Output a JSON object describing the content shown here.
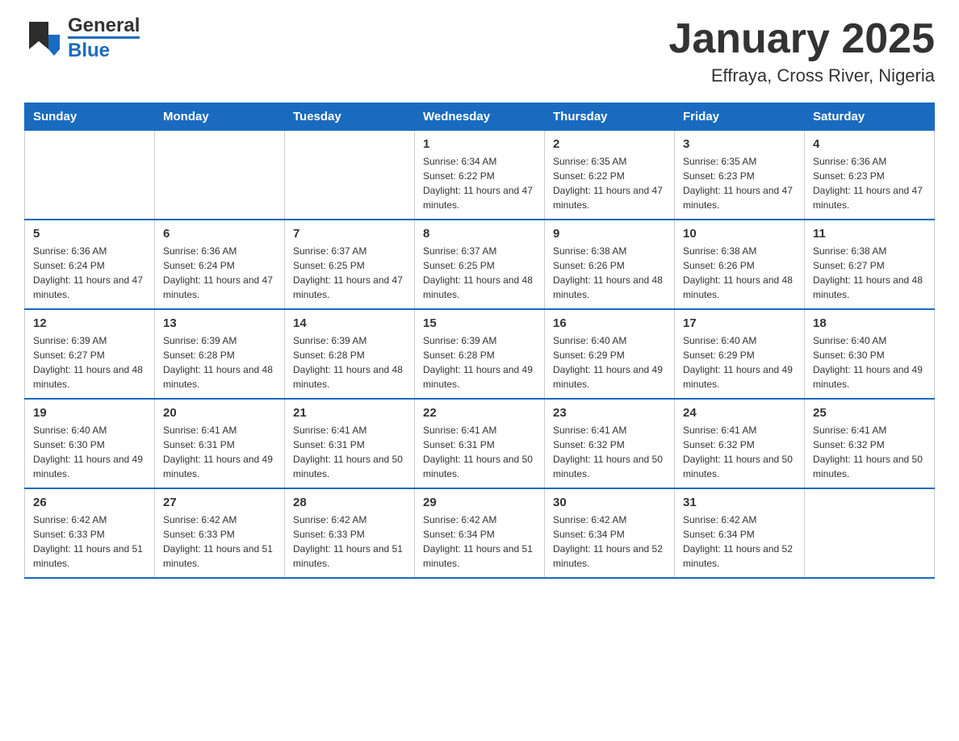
{
  "header": {
    "logo": {
      "general": "General",
      "blue": "Blue",
      "arrow_symbol": "▶"
    },
    "month_title": "January 2025",
    "location": "Effraya, Cross River, Nigeria"
  },
  "calendar": {
    "days_of_week": [
      "Sunday",
      "Monday",
      "Tuesday",
      "Wednesday",
      "Thursday",
      "Friday",
      "Saturday"
    ],
    "weeks": [
      {
        "days": [
          {
            "number": "",
            "info": ""
          },
          {
            "number": "",
            "info": ""
          },
          {
            "number": "",
            "info": ""
          },
          {
            "number": "1",
            "info": "Sunrise: 6:34 AM\nSunset: 6:22 PM\nDaylight: 11 hours and 47 minutes."
          },
          {
            "number": "2",
            "info": "Sunrise: 6:35 AM\nSunset: 6:22 PM\nDaylight: 11 hours and 47 minutes."
          },
          {
            "number": "3",
            "info": "Sunrise: 6:35 AM\nSunset: 6:23 PM\nDaylight: 11 hours and 47 minutes."
          },
          {
            "number": "4",
            "info": "Sunrise: 6:36 AM\nSunset: 6:23 PM\nDaylight: 11 hours and 47 minutes."
          }
        ]
      },
      {
        "days": [
          {
            "number": "5",
            "info": "Sunrise: 6:36 AM\nSunset: 6:24 PM\nDaylight: 11 hours and 47 minutes."
          },
          {
            "number": "6",
            "info": "Sunrise: 6:36 AM\nSunset: 6:24 PM\nDaylight: 11 hours and 47 minutes."
          },
          {
            "number": "7",
            "info": "Sunrise: 6:37 AM\nSunset: 6:25 PM\nDaylight: 11 hours and 47 minutes."
          },
          {
            "number": "8",
            "info": "Sunrise: 6:37 AM\nSunset: 6:25 PM\nDaylight: 11 hours and 48 minutes."
          },
          {
            "number": "9",
            "info": "Sunrise: 6:38 AM\nSunset: 6:26 PM\nDaylight: 11 hours and 48 minutes."
          },
          {
            "number": "10",
            "info": "Sunrise: 6:38 AM\nSunset: 6:26 PM\nDaylight: 11 hours and 48 minutes."
          },
          {
            "number": "11",
            "info": "Sunrise: 6:38 AM\nSunset: 6:27 PM\nDaylight: 11 hours and 48 minutes."
          }
        ]
      },
      {
        "days": [
          {
            "number": "12",
            "info": "Sunrise: 6:39 AM\nSunset: 6:27 PM\nDaylight: 11 hours and 48 minutes."
          },
          {
            "number": "13",
            "info": "Sunrise: 6:39 AM\nSunset: 6:28 PM\nDaylight: 11 hours and 48 minutes."
          },
          {
            "number": "14",
            "info": "Sunrise: 6:39 AM\nSunset: 6:28 PM\nDaylight: 11 hours and 48 minutes."
          },
          {
            "number": "15",
            "info": "Sunrise: 6:39 AM\nSunset: 6:28 PM\nDaylight: 11 hours and 49 minutes."
          },
          {
            "number": "16",
            "info": "Sunrise: 6:40 AM\nSunset: 6:29 PM\nDaylight: 11 hours and 49 minutes."
          },
          {
            "number": "17",
            "info": "Sunrise: 6:40 AM\nSunset: 6:29 PM\nDaylight: 11 hours and 49 minutes."
          },
          {
            "number": "18",
            "info": "Sunrise: 6:40 AM\nSunset: 6:30 PM\nDaylight: 11 hours and 49 minutes."
          }
        ]
      },
      {
        "days": [
          {
            "number": "19",
            "info": "Sunrise: 6:40 AM\nSunset: 6:30 PM\nDaylight: 11 hours and 49 minutes."
          },
          {
            "number": "20",
            "info": "Sunrise: 6:41 AM\nSunset: 6:31 PM\nDaylight: 11 hours and 49 minutes."
          },
          {
            "number": "21",
            "info": "Sunrise: 6:41 AM\nSunset: 6:31 PM\nDaylight: 11 hours and 50 minutes."
          },
          {
            "number": "22",
            "info": "Sunrise: 6:41 AM\nSunset: 6:31 PM\nDaylight: 11 hours and 50 minutes."
          },
          {
            "number": "23",
            "info": "Sunrise: 6:41 AM\nSunset: 6:32 PM\nDaylight: 11 hours and 50 minutes."
          },
          {
            "number": "24",
            "info": "Sunrise: 6:41 AM\nSunset: 6:32 PM\nDaylight: 11 hours and 50 minutes."
          },
          {
            "number": "25",
            "info": "Sunrise: 6:41 AM\nSunset: 6:32 PM\nDaylight: 11 hours and 50 minutes."
          }
        ]
      },
      {
        "days": [
          {
            "number": "26",
            "info": "Sunrise: 6:42 AM\nSunset: 6:33 PM\nDaylight: 11 hours and 51 minutes."
          },
          {
            "number": "27",
            "info": "Sunrise: 6:42 AM\nSunset: 6:33 PM\nDaylight: 11 hours and 51 minutes."
          },
          {
            "number": "28",
            "info": "Sunrise: 6:42 AM\nSunset: 6:33 PM\nDaylight: 11 hours and 51 minutes."
          },
          {
            "number": "29",
            "info": "Sunrise: 6:42 AM\nSunset: 6:34 PM\nDaylight: 11 hours and 51 minutes."
          },
          {
            "number": "30",
            "info": "Sunrise: 6:42 AM\nSunset: 6:34 PM\nDaylight: 11 hours and 52 minutes."
          },
          {
            "number": "31",
            "info": "Sunrise: 6:42 AM\nSunset: 6:34 PM\nDaylight: 11 hours and 52 minutes."
          },
          {
            "number": "",
            "info": ""
          }
        ]
      }
    ]
  }
}
